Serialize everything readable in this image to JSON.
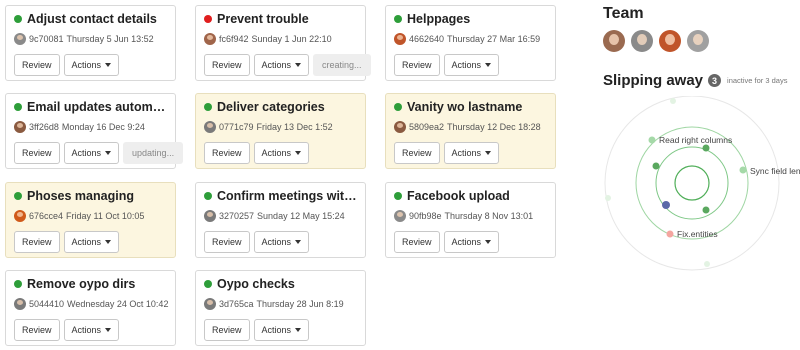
{
  "cards": [
    {
      "title": "Adjust contact details",
      "dot_color": "#2e9e3a",
      "warn": false,
      "avatar_color": "#8a8a8a",
      "hash": "9c70081",
      "date": "Thursday 5 Jun 13:52",
      "review_label": "Review",
      "actions_label": "Actions",
      "status": ""
    },
    {
      "title": "Prevent trouble",
      "dot_color": "#e01e1e",
      "warn": false,
      "avatar_color": "#a0654a",
      "hash": "fc6f942",
      "date": "Sunday 1 Jun 22:10",
      "review_label": "Review",
      "actions_label": "Actions",
      "status": "creating..."
    },
    {
      "title": "Helppages",
      "dot_color": "#2e9e3a",
      "warn": false,
      "avatar_color": "#c0552a",
      "hash": "4662640",
      "date": "Thursday 27 Mar 16:59",
      "review_label": "Review",
      "actions_label": "Actions",
      "status": ""
    },
    {
      "title": "Email updates automagi…",
      "dot_color": "#2e9e3a",
      "warn": false,
      "avatar_color": "#8a5a40",
      "hash": "3ff26d8",
      "date": "Monday 16 Dec 9:24",
      "review_label": "Review",
      "actions_label": "Actions",
      "status": "updating..."
    },
    {
      "title": "Deliver categories",
      "dot_color": "#2e9e3a",
      "warn": true,
      "avatar_color": "#7a7a7a",
      "hash": "0771c79",
      "date": "Friday 13 Dec 1:52",
      "review_label": "Review",
      "actions_label": "Actions",
      "status": ""
    },
    {
      "title": "Vanity wo lastname",
      "dot_color": "#2e9e3a",
      "warn": true,
      "avatar_color": "#8a5a40",
      "hash": "5809ea2",
      "date": "Thursday 12 Dec 18:28",
      "review_label": "Review",
      "actions_label": "Actions",
      "status": ""
    },
    {
      "title": "Phoses managing",
      "dot_color": "#2e9e3a",
      "warn": true,
      "avatar_color": "#d05a1a",
      "hash": "676cce4",
      "date": "Friday 11 Oct 10:05",
      "review_label": "Review",
      "actions_label": "Actions",
      "status": ""
    },
    {
      "title": "Confirm meetings witho…",
      "dot_color": "#2e9e3a",
      "warn": false,
      "avatar_color": "#7a7a7a",
      "hash": "3270257",
      "date": "Sunday 12 May 15:24",
      "review_label": "Review",
      "actions_label": "Actions",
      "status": ""
    },
    {
      "title": "Facebook upload",
      "dot_color": "#2e9e3a",
      "warn": false,
      "avatar_color": "#8a8a8a",
      "hash": "90fb98e",
      "date": "Thursday 8 Nov 13:01",
      "review_label": "Review",
      "actions_label": "Actions",
      "status": ""
    },
    {
      "title": "Remove oypo dirs",
      "dot_color": "#2e9e3a",
      "warn": false,
      "avatar_color": "#7a7a7a",
      "hash": "5044410",
      "date": "Wednesday 24 Oct 10:42",
      "review_label": "Review",
      "actions_label": "Actions",
      "status": ""
    },
    {
      "title": "Oypo checks",
      "dot_color": "#2e9e3a",
      "warn": false,
      "avatar_color": "#7a7a7a",
      "hash": "3d765ca",
      "date": "Thursday 28 Jun 8:19",
      "review_label": "Review",
      "actions_label": "Actions",
      "status": ""
    }
  ],
  "team": {
    "heading": "Team",
    "members": [
      {
        "avatar_color": "#9a6a50"
      },
      {
        "avatar_color": "#8a8a8a"
      },
      {
        "avatar_color": "#c0552a"
      },
      {
        "avatar_color": "#a0a0a0"
      }
    ]
  },
  "slipping": {
    "heading": "Slipping away",
    "count": "3",
    "note": "inactive for 3 days",
    "labels": [
      "Read right columns",
      "Sync field len",
      "Fix.entities"
    ]
  }
}
